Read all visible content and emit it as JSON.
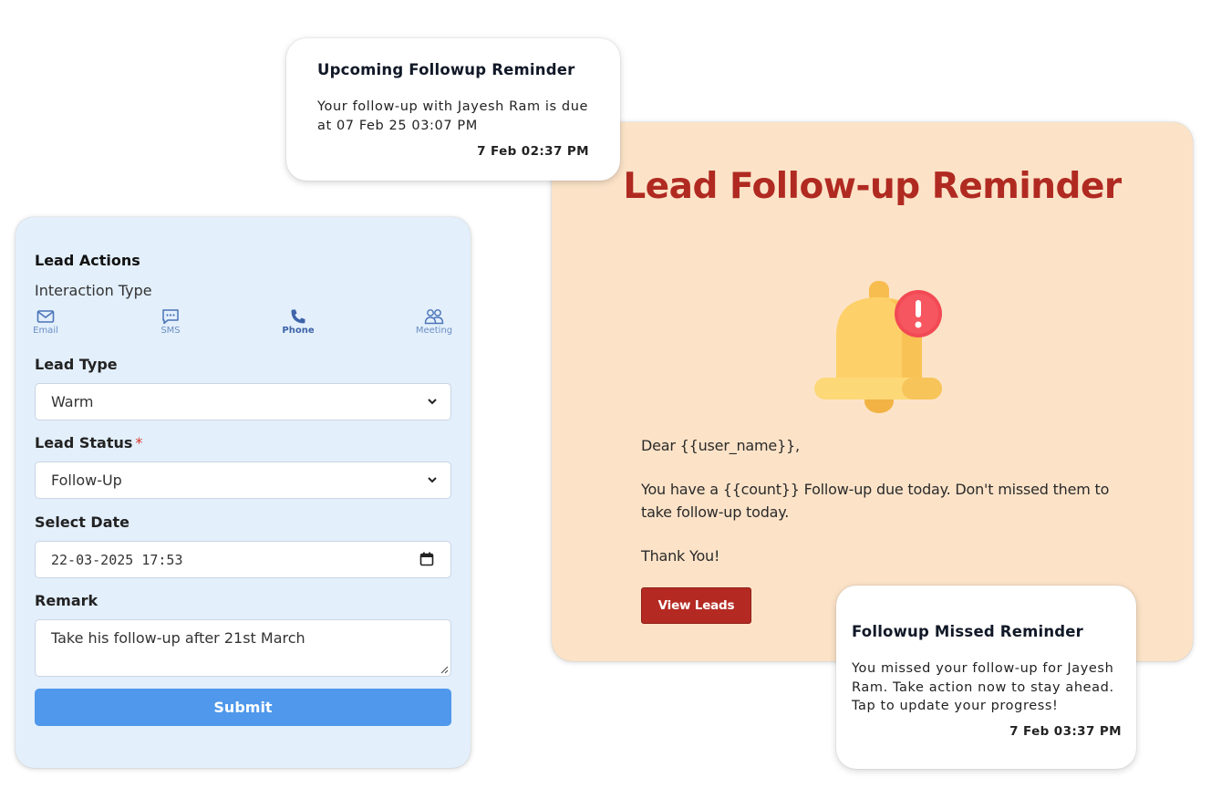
{
  "notifications": {
    "upcoming": {
      "title": "Upcoming Followup Reminder",
      "body": "Your follow-up with Jayesh  Ram is due at 07 Feb 25 03:07 PM",
      "time": "7 Feb 02:37 PM"
    },
    "missed": {
      "title": "Followup Missed Reminder",
      "body": "You missed your follow-up for Jayesh Ram. Take action now to stay ahead. Tap to update your progress!",
      "time": "7 Feb 03:37 PM"
    }
  },
  "email": {
    "title": "Lead Follow-up Reminder",
    "greeting": "Dear {{user_name}},",
    "message": "You have a {{count}} Follow-up due today. Don't missed them to take follow-up today.",
    "thanks": "Thank You!",
    "button_label": "View Leads",
    "bell_icon": "bell-alert-icon",
    "colors": {
      "background": "#fce3c8",
      "title": "#b02a21",
      "button": "#b42a22"
    }
  },
  "lead_form": {
    "heading": "Lead Actions",
    "interaction_type_label": "Interaction Type",
    "interaction_types": [
      {
        "label": "Email",
        "icon": "envelope-icon",
        "active": false
      },
      {
        "label": "SMS",
        "icon": "chat-icon",
        "active": false
      },
      {
        "label": "Phone",
        "icon": "phone-icon",
        "active": true
      },
      {
        "label": "Meeting",
        "icon": "people-icon",
        "active": false
      }
    ],
    "lead_type": {
      "label": "Lead Type",
      "value": "Warm"
    },
    "lead_status": {
      "label": "Lead Status",
      "required_mark": "*",
      "value": "Follow-Up"
    },
    "select_date": {
      "label": "Select Date",
      "value": "22-03-2025 17:53"
    },
    "remark": {
      "label": "Remark",
      "value": "Take his follow-up after 21st March"
    },
    "submit_label": "Submit",
    "colors": {
      "background": "#e3effb",
      "submit": "#4f98eb",
      "accent": "#4a73b8"
    }
  }
}
